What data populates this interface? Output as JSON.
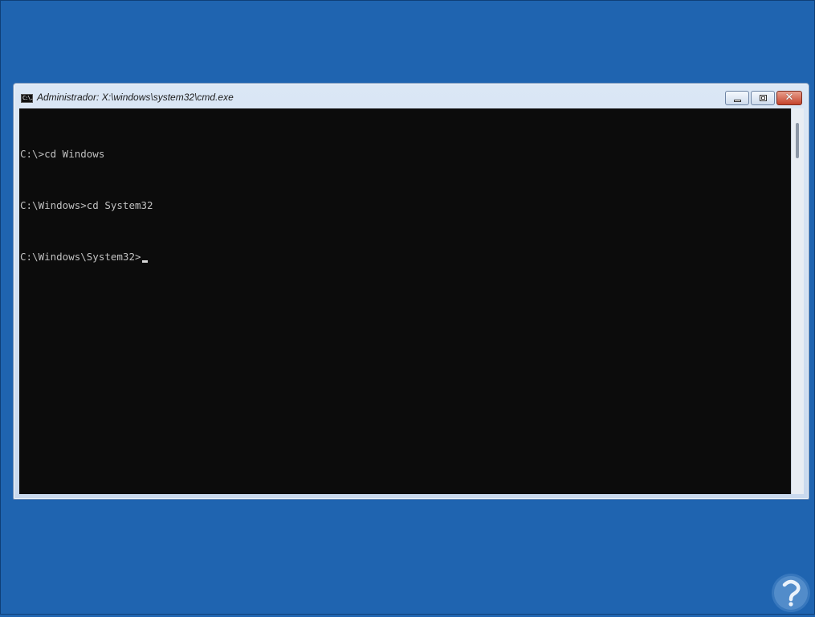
{
  "window": {
    "title": "Administrador: X:\\windows\\system32\\cmd.exe",
    "icon": "cmd-icon",
    "icon_text": "C:\\.",
    "buttons": {
      "minimize": "minimize-icon",
      "maximize": "maximize-icon",
      "close_glyph": "✕"
    }
  },
  "console": {
    "lines": [
      "C:\\>cd Windows",
      "C:\\Windows>cd System32",
      "C:\\Windows\\System32>"
    ],
    "text_color": "#c0c0c0",
    "background": "#0c0c0c"
  },
  "desktop": {
    "background": "#1f64b0"
  },
  "watermark": {
    "icon": "solvetic-logo-icon"
  }
}
